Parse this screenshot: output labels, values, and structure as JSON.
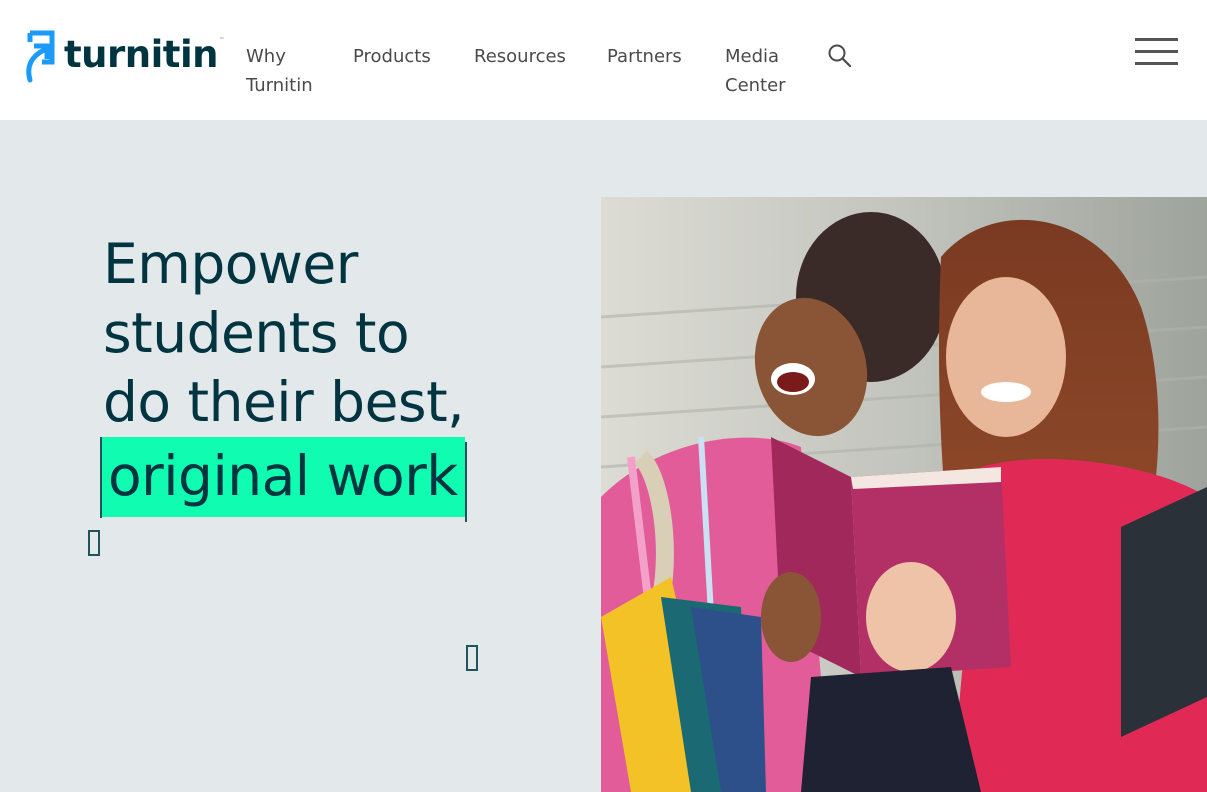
{
  "header": {
    "logo": {
      "text": "turnitin",
      "trademark": "™",
      "icon": "turnitin-arrow-icon",
      "color": "#003440",
      "accent": "#1a9bfc"
    },
    "nav": [
      {
        "label_line1": "Why",
        "label_line2": "Turnitin"
      },
      {
        "label_line1": "Products"
      },
      {
        "label_line1": "Resources"
      },
      {
        "label_line1": "Partners"
      },
      {
        "label_line1": "Media",
        "label_line2": "Center"
      }
    ],
    "search_icon": "search-icon",
    "menu_icon": "hamburger-menu-icon"
  },
  "hero": {
    "headline_lines": [
      "Empower",
      "students to",
      "do their best,"
    ],
    "highlighted_text": "original work",
    "highlight_color": "#0ffcb1",
    "background_color": "#e3e8eb",
    "text_color": "#003440",
    "image_alt": "Two laughing students reading a book outdoors"
  }
}
